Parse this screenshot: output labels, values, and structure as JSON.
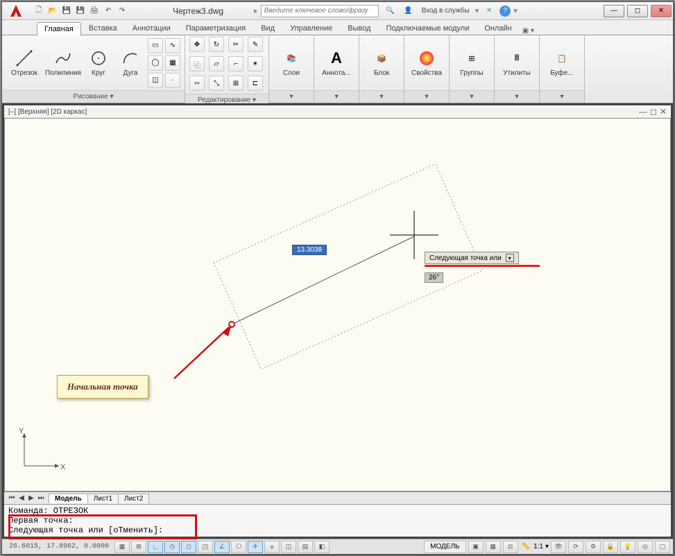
{
  "title": "Чертеж3.dwg",
  "search_placeholder": "Введите ключевое слово/фразу",
  "login_text": "Вход в службы",
  "tabs": [
    "Главная",
    "Вставка",
    "Аннотации",
    "Параметризация",
    "Вид",
    "Управление",
    "Вывод",
    "Подключаемые модули",
    "Онлайн"
  ],
  "ribbon": {
    "draw": {
      "line": "Отрезок",
      "polyline": "Полилиния",
      "circle": "Круг",
      "arc": "Дуга",
      "panel_title": "Рисование ▾"
    },
    "edit": {
      "panel_title": "Редактирование ▾"
    },
    "layers": "Слои",
    "annot": "Аннота...",
    "block": "Блок",
    "props": "Свойства",
    "groups": "Группы",
    "utils": "Утилиты",
    "clip": "Буфе..."
  },
  "viewport_label": "[–] [Верхняя] [2D каркас]",
  "dyn_distance": "13.3038",
  "dyn_prompt": "Следующая точка или",
  "dyn_angle": "26°",
  "callout": "Начальная точка",
  "layout_tabs": [
    "Модель",
    "Лист1",
    "Лист2"
  ],
  "cmd": {
    "l1": "Команда: ОТРЕЗОК",
    "l2": "Первая точка:",
    "l3": "Следующая точка или [оТменить]:"
  },
  "status": {
    "coords": "26.6015, 17.8962, 0.0000",
    "model": "МОДЕЛЬ",
    "scale": "1:1"
  }
}
